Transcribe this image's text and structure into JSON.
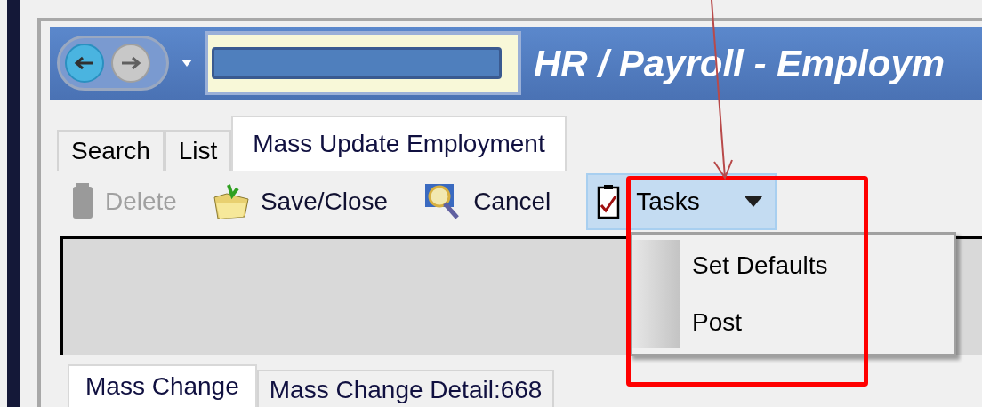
{
  "window": {
    "title": "HR / Payroll - Employm"
  },
  "tabs": [
    {
      "label": "Search",
      "selected": false
    },
    {
      "label": "List",
      "selected": false
    },
    {
      "label": "Mass Update Employment",
      "selected": true
    }
  ],
  "toolbar": [
    {
      "kind": "delete",
      "label": "Delete",
      "disabled": true
    },
    {
      "kind": "save",
      "label": "Save/Close",
      "disabled": false
    },
    {
      "kind": "cancel",
      "label": "Cancel",
      "disabled": false
    }
  ],
  "tasks_menu": {
    "label": "Tasks",
    "expanded": true,
    "items": [
      "Set Defaults",
      "Post"
    ]
  },
  "bottom_tabs": [
    {
      "label": "Mass Change",
      "selected": true
    },
    {
      "label": "Mass Change Detail:668",
      "selected": false
    }
  ]
}
